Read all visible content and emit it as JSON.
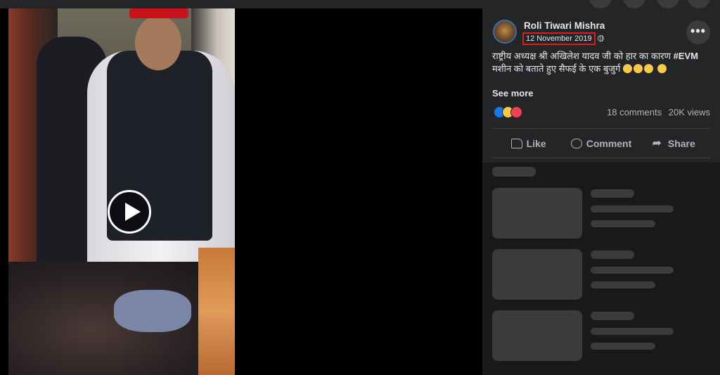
{
  "post": {
    "author": "Roli Tiwari Mishra",
    "date": "12 November 2019",
    "caption_text": "राष्ट्रीय अध्यक्ष श्री अखिलेश यादव जी को हार का कारण",
    "hashtag": "#EVM",
    "caption_rest": " मशीन को बताते हुए सैफई के एक बुजुर्ग",
    "see_more": "See more",
    "more_button": "•••"
  },
  "stats": {
    "comments": "18 comments",
    "views": "20K views"
  },
  "actions": {
    "like": "Like",
    "comment": "Comment",
    "share": "Share"
  },
  "colors": {
    "background": "#18191a",
    "panel": "#242526",
    "highlight_box": "#e01c1c",
    "like_blue": "#1877f2"
  }
}
